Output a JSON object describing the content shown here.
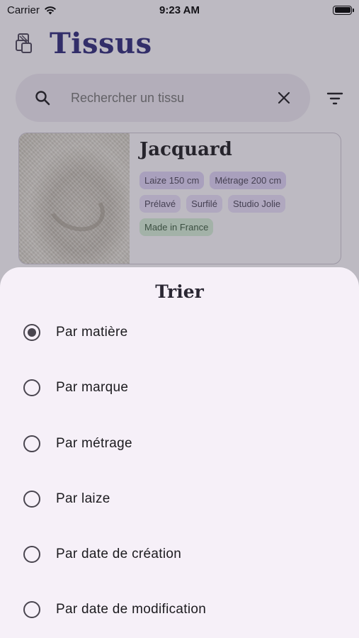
{
  "status_bar": {
    "carrier": "Carrier",
    "time": "9:23 AM"
  },
  "app_bar": {
    "title": "Tissus"
  },
  "search": {
    "placeholder": "Rechercher un tissu"
  },
  "fabric_card": {
    "name": "Jacquard",
    "chips": [
      [
        "Laize 150 cm",
        "Métrage 200 cm"
      ],
      [
        "Prélavé",
        "Surfilé",
        "Studio Jolie"
      ],
      [
        "Made in France"
      ]
    ]
  },
  "sort_sheet": {
    "title": "Trier",
    "selected_index": 0,
    "options": [
      "Par matière",
      "Par marque",
      "Par métrage",
      "Par laize",
      "Par date de création",
      "Par date de modification"
    ]
  },
  "colors": {
    "brand": "#2e2a7a",
    "sheet_background": "#f6f0f8",
    "chip_purple": "#e8def8",
    "chip_green": "#d5ecd6"
  },
  "icons": {
    "logo": "fabric-swatch-icon",
    "search": "search-icon",
    "clear": "close-icon",
    "filter": "filter-icon",
    "wifi": "wifi-icon",
    "battery": "battery-icon"
  }
}
